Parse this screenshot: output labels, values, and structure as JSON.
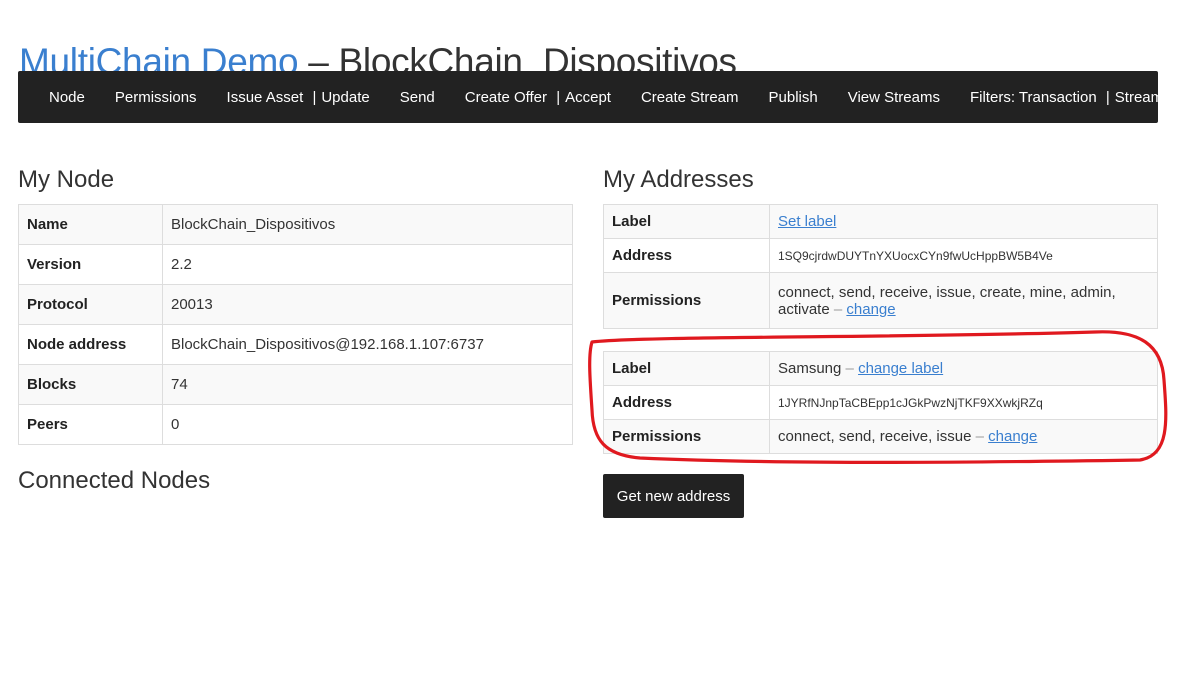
{
  "header": {
    "brand": "MultiChain Demo",
    "separator": " – ",
    "chain_name": "BlockChain_Dispositivos"
  },
  "nav": {
    "node": "Node",
    "permissions": "Permissions",
    "issue_asset": "Issue Asset",
    "update": "Update",
    "send": "Send",
    "create_offer": "Create Offer",
    "accept": "Accept",
    "create_stream": "Create Stream",
    "publish": "Publish",
    "view_streams": "View Streams",
    "filters_prefix": "Filters: ",
    "transaction": "Transaction",
    "stream": "Stream",
    "divider": "|"
  },
  "my_node": {
    "title": "My Node",
    "rows": [
      {
        "key": "Name",
        "value": "BlockChain_Dispositivos"
      },
      {
        "key": "Version",
        "value": "2.2"
      },
      {
        "key": "Protocol",
        "value": "20013"
      },
      {
        "key": "Node address",
        "value": "BlockChain_Dispositivos@192.168.1.107:6737"
      },
      {
        "key": "Blocks",
        "value": "74"
      },
      {
        "key": "Peers",
        "value": "0"
      }
    ]
  },
  "connected_nodes": {
    "title": "Connected Nodes"
  },
  "my_addresses": {
    "title": "My Addresses",
    "label_key": "Label",
    "address_key": "Address",
    "permissions_key": "Permissions",
    "dash": " – ",
    "addresses": [
      {
        "label_link": "Set label",
        "address": "1SQ9cjrdwDUYTnYXUocxCYn9fwUcHppBW5B4Ve",
        "permissions": "connect, send, receive, issue, create, mine, admin, activate",
        "change_link": "change"
      },
      {
        "label": "Samsung",
        "label_link": "change label",
        "address": "1JYRfNJnpTaCBEpp1cJGkPwzNjTKF9XXwkjRZq",
        "permissions": "connect, send, receive, issue",
        "change_link": "change"
      }
    ]
  },
  "get_new_address_button": "Get new address",
  "annotation": {
    "color": "#e0191f"
  }
}
